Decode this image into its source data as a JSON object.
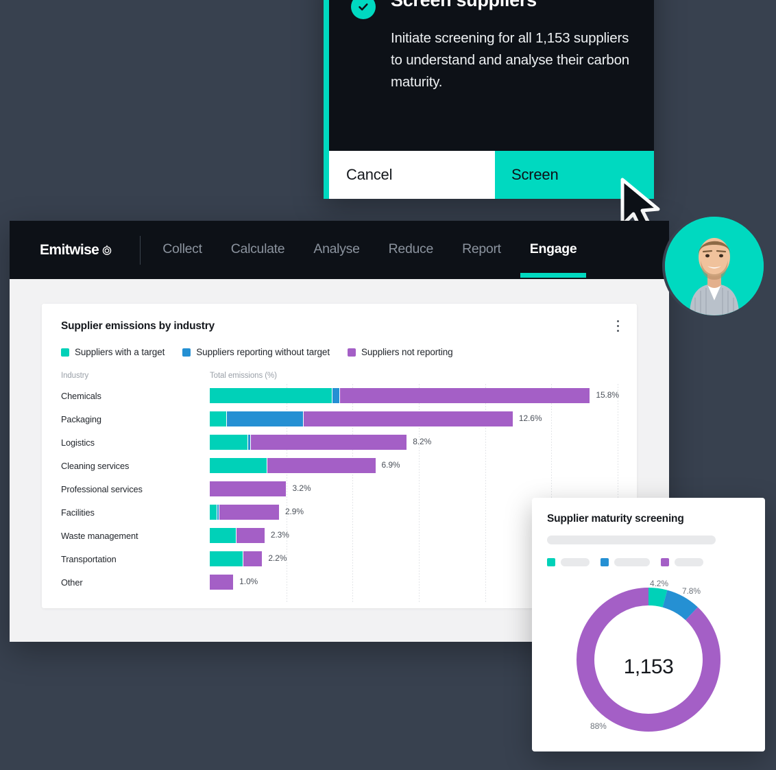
{
  "colors": {
    "teal": "#00d1b8",
    "blue": "#2590d3",
    "purple": "#a45fc6",
    "dark": "#0d1117",
    "page_bg": "#38414f",
    "panel_bg": "#f2f2f3"
  },
  "modal": {
    "icon": "check-circle-icon",
    "title": "Screen suppliers",
    "description": "Initiate screening for all 1,153 suppliers to understand and analyse their carbon maturity.",
    "cancel_label": "Cancel",
    "confirm_label": "Screen"
  },
  "cursor": {
    "icon": "mouse-pointer-icon"
  },
  "navbar": {
    "logo_text": "Emitwise",
    "logo_icon": "emitwise-ring-icon",
    "items": [
      {
        "label": "Collect",
        "active": false
      },
      {
        "label": "Calculate",
        "active": false
      },
      {
        "label": "Analyse",
        "active": false
      },
      {
        "label": "Reduce",
        "active": false
      },
      {
        "label": "Report",
        "active": false
      },
      {
        "label": "Engage",
        "active": true
      }
    ]
  },
  "avatar": {
    "alt": "user-avatar"
  },
  "chart_card": {
    "title": "Supplier emissions by industry",
    "menu_icon": "kebab-menu-icon",
    "axis_industry_label": "Industry",
    "axis_value_label": "Total emissions (%)"
  },
  "chart_data": {
    "type": "bar",
    "orientation": "horizontal",
    "stacked": true,
    "title": "Supplier emissions by industry",
    "xlabel": "Total emissions (%)",
    "ylabel": "Industry",
    "grid": true,
    "legend_position": "top",
    "xlim": [
      0,
      16.5
    ],
    "legend": [
      {
        "name": "Suppliers with a target",
        "color": "#00d1b8"
      },
      {
        "name": "Suppliers reporting without target",
        "color": "#2590d3"
      },
      {
        "name": "Suppliers not reporting",
        "color": "#a45fc6"
      }
    ],
    "categories": [
      "Chemicals",
      "Packaging",
      "Logistics",
      "Cleaning services",
      "Professional services",
      "Facilities",
      "Waste management",
      "Transportation",
      "Other"
    ],
    "totals": [
      "15.8%",
      "12.6%",
      "8.2%",
      "6.9%",
      "3.2%",
      "2.9%",
      "2.3%",
      "2.2%",
      "1.0%"
    ],
    "total_values": [
      15.8,
      12.6,
      8.2,
      6.9,
      3.2,
      2.9,
      2.3,
      2.2,
      1.0
    ],
    "series": [
      {
        "name": "Suppliers with a target",
        "values": [
          5.1,
          0.7,
          1.6,
          2.4,
          0.0,
          0.3,
          1.1,
          1.4,
          0.0
        ]
      },
      {
        "name": "Suppliers reporting without target",
        "values": [
          0.3,
          3.2,
          0.1,
          0.0,
          0.0,
          0.1,
          0.0,
          0.0,
          0.0
        ]
      },
      {
        "name": "Suppliers not reporting",
        "values": [
          10.4,
          8.7,
          6.5,
          4.5,
          3.2,
          2.5,
          1.2,
          0.8,
          1.0
        ]
      }
    ]
  },
  "donut_panel": {
    "title": "Supplier maturity screening",
    "center_value": "1,153",
    "labels": {
      "teal": "4.2%",
      "blue": "7.8%",
      "purple": "88%"
    }
  },
  "donut_chart_data": {
    "type": "pie",
    "title": "Supplier maturity screening",
    "center_label": "1,153",
    "categories": [
      "Suppliers with a target",
      "Suppliers reporting without target",
      "Suppliers not reporting"
    ],
    "values": [
      4.2,
      7.8,
      88.0
    ],
    "value_labels": [
      "4.2%",
      "7.8%",
      "88%"
    ],
    "colors": [
      "#00d1b8",
      "#2590d3",
      "#a45fc6"
    ]
  }
}
